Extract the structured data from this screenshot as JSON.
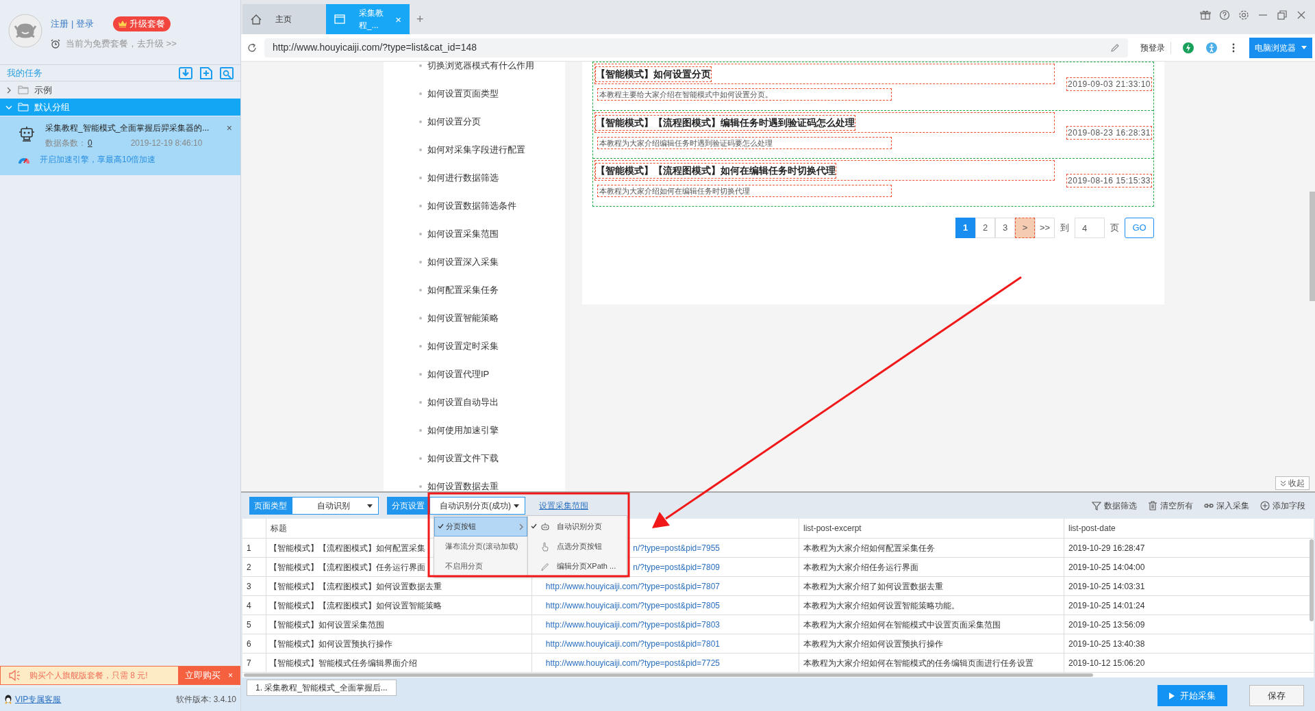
{
  "account": {
    "register": "注册",
    "separator": "|",
    "login": "登录",
    "upgrade": "升级套餐",
    "plan_notice": "当前为免费套餐，去升级 >>"
  },
  "tasks_header": "我的任务",
  "tree": [
    {
      "label": "示例",
      "expanded": false,
      "selected": false
    },
    {
      "label": "默认分组",
      "expanded": true,
      "selected": true,
      "children": [
        {
          "title": "采集教程_智能模式_全面掌握后羿采集器的...",
          "count_label": "数据条数：",
          "count": "0",
          "date": "2019-12-19 8:46:10",
          "promo": "开启加速引擎，享最高10倍加速"
        }
      ]
    }
  ],
  "ad": {
    "text": "购买个人旗舰版套餐，只需 8 元!",
    "button": "立即购买",
    "close": "×"
  },
  "footer": {
    "support": "VIP专属客服",
    "version": "软件版本: 3.4.10"
  },
  "browser": {
    "tabs": [
      {
        "label": "主页",
        "kind": "home",
        "selected": false
      },
      {
        "label": "采集教程_...",
        "kind": "page",
        "selected": true
      }
    ],
    "close_tab": "×",
    "new_tab": "+",
    "url": "http://www.houyicaiji.com/?type=list&cat_id=148",
    "prelogin": "预登录",
    "mode_button": "电脑浏览器"
  },
  "page": {
    "nav": [
      "切换浏览器模式有什么作用",
      "如何设置页面类型",
      "如何设置分页",
      "如何对采集字段进行配置",
      "如何进行数据筛选",
      "如何设置数据筛选条件",
      "如何设置采集范围",
      "如何设置深入采集",
      "如何配置采集任务",
      "如何设置智能策略",
      "如何设置定时采集",
      "如何设置代理IP",
      "如何设置自动导出",
      "如何使用加速引擎",
      "如何设置文件下载",
      "如何设置数据去重"
    ],
    "articles": [
      {
        "title": "【智能模式】如何设置分页",
        "excerpt": "本教程主要给大家介绍在智能模式中如何设置分页。",
        "date": "2019-09-03 21:33:10"
      },
      {
        "title": "【智能模式】【流程图模式】编辑任务时遇到验证码怎么处理",
        "excerpt": "本教程为大家介绍编辑任务时遇到验证码要怎么处理",
        "date": "2019-08-23 16:28:31"
      },
      {
        "title": "【智能模式】【流程图模式】如何在编辑任务时切换代理",
        "excerpt": "本教程为大家介绍如何在编辑任务时切换代理",
        "date": "2019-08-16 15:15:33"
      }
    ],
    "pagination": {
      "pages": [
        {
          "label": "1",
          "selected": true
        },
        {
          "label": "2",
          "selected": false
        },
        {
          "label": "3",
          "selected": false
        }
      ],
      "next": ">",
      "last": ">>",
      "goto_label": "到",
      "goto_value": "4",
      "page_label": "页",
      "go": "GO"
    }
  },
  "panel": {
    "collapse": "收起",
    "page_type_label": "页面类型",
    "page_type_value": "自动识别",
    "paging_label": "分页设置",
    "paging_value": "自动识别分页(成功)",
    "range_link": "设置采集范围",
    "tools": [
      {
        "label": "数据筛选",
        "kind": "filter"
      },
      {
        "label": "清空所有",
        "kind": "trash"
      },
      {
        "label": "深入采集",
        "kind": "link"
      },
      {
        "label": "添加字段",
        "kind": "add"
      }
    ],
    "menu": [
      {
        "label": "分页按钮",
        "checked": true,
        "selected": true,
        "has_submenu": true
      },
      {
        "label": "瀑布流分页(滚动加载)",
        "checked": false,
        "selected": false,
        "has_submenu": false
      },
      {
        "label": "不启用分页",
        "checked": false,
        "selected": false,
        "has_submenu": false
      }
    ],
    "submenu": [
      {
        "label": "自动识别分页",
        "kind": "robot",
        "checked": true
      },
      {
        "label": "点选分页按钮",
        "kind": "hand",
        "checked": false
      },
      {
        "label": "编辑分页XPath ...",
        "kind": "pencil",
        "checked": false
      }
    ],
    "columns": {
      "title": "标题",
      "excerpt": "list-post-excerpt",
      "date": "list-post-date"
    },
    "rows": [
      {
        "num": "1",
        "title": "【智能模式】【流程图模式】如何配置采集",
        "url": "n/?type=post&pid=7955",
        "excerpt": "本教程为大家介绍如何配置采集任务",
        "date": "2019-10-29 16:28:47"
      },
      {
        "num": "2",
        "title": "【智能模式】【流程图模式】任务运行界面",
        "url": "n/?type=post&pid=7809",
        "excerpt": "本教程为大家介绍任务运行界面",
        "date": "2019-10-25 14:04:00"
      },
      {
        "num": "3",
        "title": "【智能模式】【流程图模式】如何设置数据去重",
        "url": "http://www.houyicaiji.com/?type=post&pid=7807",
        "excerpt": "本教程为大家介绍了如何设置数据去重",
        "date": "2019-10-25 14:03:31"
      },
      {
        "num": "4",
        "title": "【智能模式】【流程图模式】如何设置智能策略",
        "url": "http://www.houyicaiji.com/?type=post&pid=7805",
        "excerpt": "本教程为大家介绍如何设置智能策略功能。",
        "date": "2019-10-25 14:01:24"
      },
      {
        "num": "5",
        "title": "【智能模式】如何设置采集范围",
        "url": "http://www.houyicaiji.com/?type=post&pid=7803",
        "excerpt": "本教程为大家介绍如何在智能模式中设置页面采集范围",
        "date": "2019-10-25 13:56:09"
      },
      {
        "num": "6",
        "title": "【智能模式】如何设置预执行操作",
        "url": "http://www.houyicaiji.com/?type=post&pid=7801",
        "excerpt": "本教程为大家介绍如何设置预执行操作",
        "date": "2019-10-25 13:40:38"
      },
      {
        "num": "7",
        "title": "【智能模式】智能模式任务编辑界面介绍",
        "url": "http://www.houyicaiji.com/?type=post&pid=7725",
        "excerpt": "本教程为大家介绍如何在智能模式的任务编辑页面进行任务设置",
        "date": "2019-10-12 15:06:20"
      }
    ],
    "task_tabs": [
      "1. 采集教程_智能模式_全面掌握后..."
    ],
    "start_button": "开始采集",
    "save_button": "保存"
  }
}
